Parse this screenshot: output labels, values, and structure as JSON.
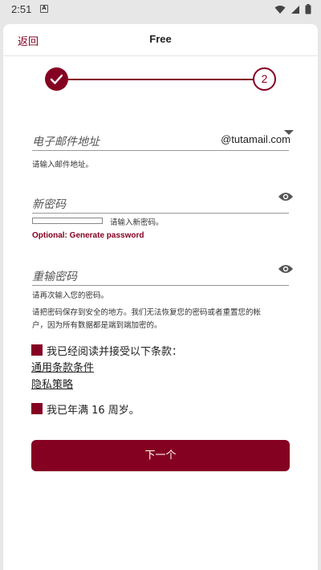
{
  "status_bar": {
    "time": "2:51",
    "notification_glyph": "A"
  },
  "header": {
    "back_label": "返回",
    "title": "Free"
  },
  "stepper": {
    "current_step": 2,
    "step2_label": "2",
    "step1_state": "complete"
  },
  "email": {
    "label": "电子邮件地址",
    "domain": "@tutamail.com",
    "helper": "请输入邮件地址。"
  },
  "new_password": {
    "label": "新密码",
    "strength_helper": "请输入新密码。",
    "generate_link": "Optional: Generate password",
    "strength_fraction": 0
  },
  "repeat_password": {
    "label": "重输密码",
    "helper": "请再次输入您的密码。"
  },
  "password_notice": {
    "line1": "请把密码保存到安全的地方。我们无法恢复您的密码或者重置您的帐",
    "line2": "户，因为所有数据都是端到端加密的。"
  },
  "terms": {
    "checkbox_label": "我已经阅读并接受以下条款：",
    "terms_link": "通用条款条件",
    "privacy_link": "隐私策略"
  },
  "age": {
    "checkbox_label": "我已年满 16 周岁。"
  },
  "next_button": {
    "label": "下一个"
  },
  "colors": {
    "accent": "#850122",
    "background": "#ffffff",
    "status_bar": "#e7e7e7"
  },
  "icons": {
    "eye": "eye-icon",
    "caret": "caret-down-icon",
    "check": "check-icon"
  }
}
